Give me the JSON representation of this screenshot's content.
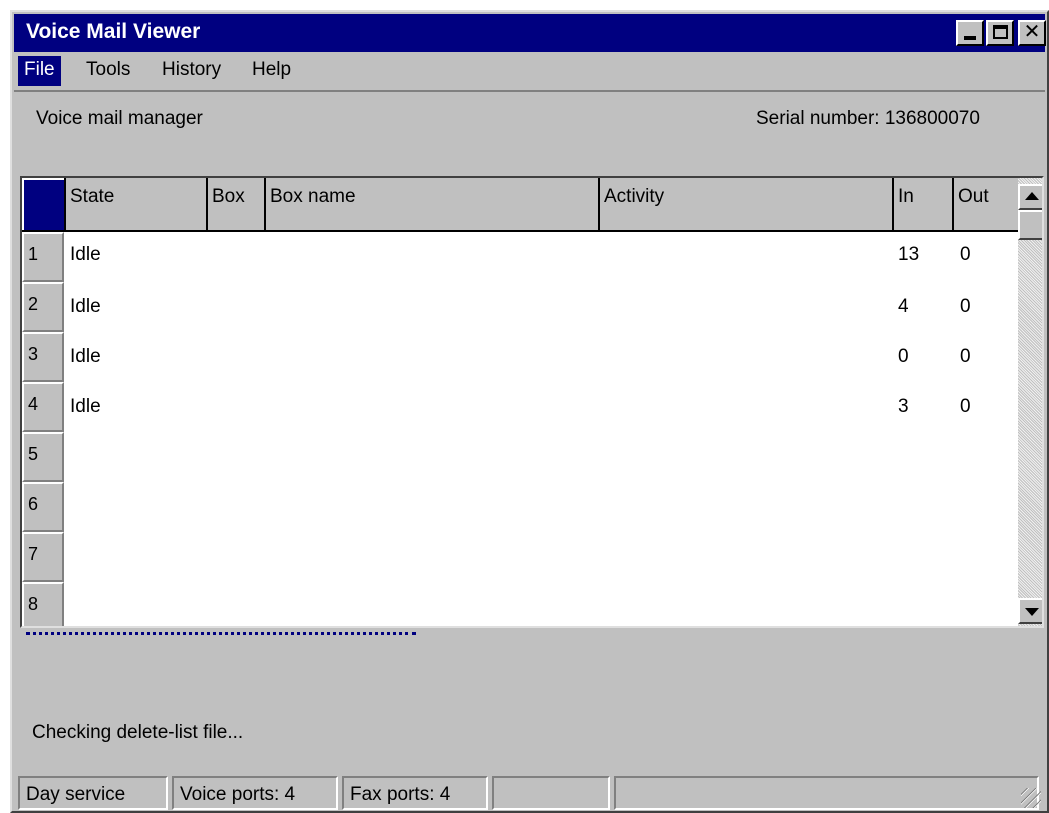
{
  "window": {
    "title": "Voice Mail Viewer"
  },
  "menu": {
    "items": [
      "File",
      "Tools",
      "History",
      "Help"
    ]
  },
  "header": {
    "left_text": "Voice mail manager",
    "right_text": "Serial number: 136800070"
  },
  "grid": {
    "columns": [
      "State",
      "Box",
      "Box name",
      "Activity",
      "In",
      "Out"
    ],
    "rows": [
      {
        "num": "1",
        "state": "Idle",
        "box": "",
        "box_name": "",
        "activity": "",
        "in": "13",
        "out": "0"
      },
      {
        "num": "2",
        "state": "Idle",
        "box": "",
        "box_name": "",
        "activity": "",
        "in": "4",
        "out": "0"
      },
      {
        "num": "3",
        "state": "Idle",
        "box": "",
        "box_name": "",
        "activity": "",
        "in": "0",
        "out": "0"
      },
      {
        "num": "4",
        "state": "Idle",
        "box": "",
        "box_name": "",
        "activity": "",
        "in": "3",
        "out": "0"
      },
      {
        "num": "5",
        "state": "",
        "box": "",
        "box_name": "",
        "activity": "",
        "in": "",
        "out": ""
      },
      {
        "num": "6",
        "state": "",
        "box": "",
        "box_name": "",
        "activity": "",
        "in": "",
        "out": ""
      },
      {
        "num": "7",
        "state": "",
        "box": "",
        "box_name": "",
        "activity": "",
        "in": "",
        "out": ""
      },
      {
        "num": "8",
        "state": "",
        "box": "",
        "box_name": "",
        "activity": "",
        "in": "",
        "out": ""
      }
    ]
  },
  "log": {
    "message": "Checking delete-list file..."
  },
  "status": {
    "panels": [
      "Day service",
      "Voice ports: 4",
      "Fax ports: 4",
      "",
      ""
    ]
  },
  "colors": {
    "titlebar": "#000080",
    "face": "#c0c0c0",
    "highlight": "#000080"
  },
  "icons": {
    "minimize": "minimize-icon",
    "maximize": "maximize-icon",
    "close": "close-icon",
    "scroll_up": "arrow-up-icon",
    "scroll_down": "arrow-down-icon",
    "grip": "size-grip-icon"
  }
}
